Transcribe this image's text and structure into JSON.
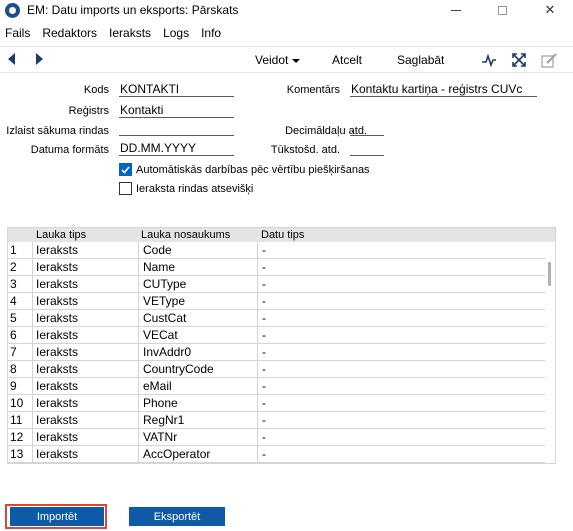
{
  "window": {
    "title": "EM: Datu imports un eksports: Pārskats"
  },
  "menu": [
    "Fails",
    "Redaktors",
    "Ieraksts",
    "Logs",
    "Info"
  ],
  "toolbar": {
    "veidot": "Veidot",
    "atcelt": "Atcelt",
    "saglabat": "Saglabāt"
  },
  "form": {
    "kods_label": "Kods",
    "kods_value": "KONTAKTI",
    "komentars_label": "Komentārs",
    "komentars_value": "Kontaktu kartiņa - reģistrs CUVc",
    "registrs_label": "Reģistrs",
    "registrs_value": "Kontakti",
    "izlaist_label": "Izlaist sākuma rindas",
    "izlaist_value": "",
    "decimal_label": "Decimāldaļu atd.",
    "decimal_value": ".",
    "datuma_label": "Datuma formāts",
    "datuma_value": "DD.MM.YYYY",
    "tukstosd_label": "Tūkstošd. atd.",
    "tukstosd_value": "",
    "auto_label": "Automātiskās darbības pēc vērtību piešķiršanas",
    "auto_checked": true,
    "atsevisk_label": "Ieraksta rindas atsevišķi",
    "atsevisk_checked": false
  },
  "grid": {
    "columns": [
      "Lauka tips",
      "Lauka nosaukums",
      "Datu tips"
    ],
    "rows": [
      {
        "num": "1",
        "type": "Ieraksts",
        "name": "Code",
        "dtype": "-"
      },
      {
        "num": "2",
        "type": "Ieraksts",
        "name": "Name",
        "dtype": "-"
      },
      {
        "num": "3",
        "type": "Ieraksts",
        "name": "CUType",
        "dtype": "-"
      },
      {
        "num": "4",
        "type": "Ieraksts",
        "name": "VEType",
        "dtype": "-"
      },
      {
        "num": "5",
        "type": "Ieraksts",
        "name": "CustCat",
        "dtype": "-"
      },
      {
        "num": "6",
        "type": "Ieraksts",
        "name": "VECat",
        "dtype": "-"
      },
      {
        "num": "7",
        "type": "Ieraksts",
        "name": "InvAddr0",
        "dtype": "-"
      },
      {
        "num": "8",
        "type": "Ieraksts",
        "name": "CountryCode",
        "dtype": "-"
      },
      {
        "num": "9",
        "type": "Ieraksts",
        "name": "eMail",
        "dtype": "-"
      },
      {
        "num": "10",
        "type": "Ieraksts",
        "name": "Phone",
        "dtype": "-"
      },
      {
        "num": "11",
        "type": "Ieraksts",
        "name": "RegNr1",
        "dtype": "-"
      },
      {
        "num": "12",
        "type": "Ieraksts",
        "name": "VATNr",
        "dtype": "-"
      },
      {
        "num": "13",
        "type": "Ieraksts",
        "name": "AccOperator",
        "dtype": "-"
      }
    ]
  },
  "buttons": {
    "import": "Importēt",
    "export": "Eksportēt"
  },
  "colors": {
    "accent": "#0e5aa7",
    "highlight": "#d94a33",
    "checkbox": "#0067c0"
  },
  "icons": [
    "app-icon",
    "back-arrow-icon",
    "forward-arrow-icon",
    "pulse-icon",
    "expand-icon",
    "edit-icon"
  ]
}
